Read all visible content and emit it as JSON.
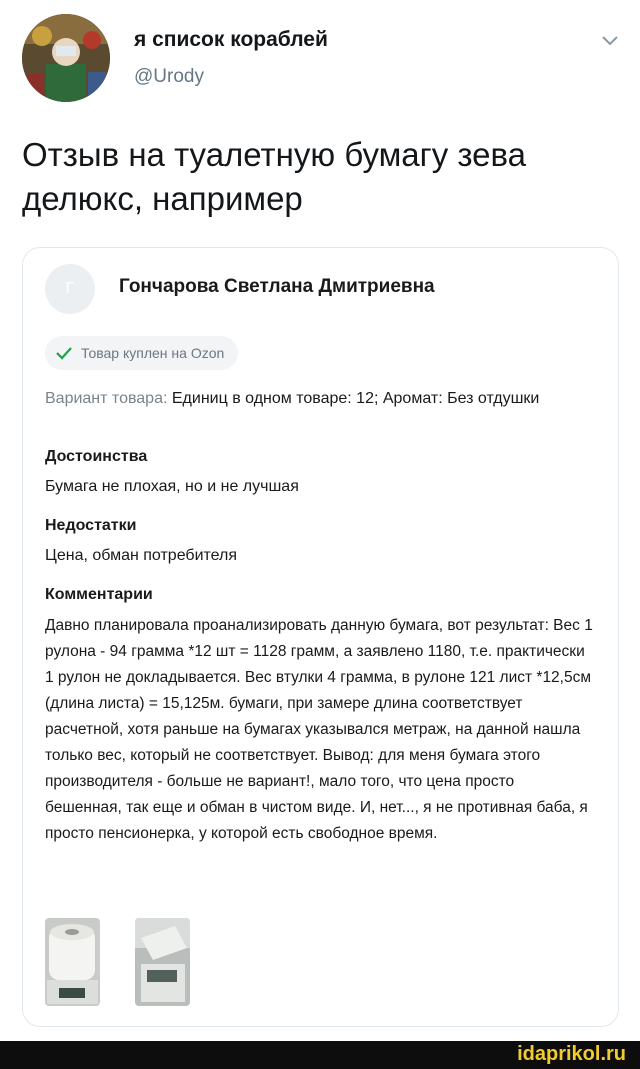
{
  "tweet": {
    "author_name": "я список кораблей",
    "handle": "@Urody",
    "text": "Отзыв на туалетную бумагу зева делюкс, например",
    "avatar_icon": "avatar-photo",
    "menu_icon": "chevron-down-icon"
  },
  "review": {
    "reviewer_initial": "Г",
    "reviewer_name": "Гончарова Светлана Дмитриевна",
    "badge": "Товар куплен на Ozon",
    "variant_label": "Вариант товара:",
    "variant_value": "Единиц в одном товаре: 12; Аромат: Без отдушки",
    "pros_title": "Достоинства",
    "pros_text": "Бумага не плохая, но и не лучшая",
    "cons_title": "Недостатки",
    "cons_text": "Цена, обман потребителя",
    "comment_title": "Комментарии",
    "comment_text": "Давно планировала проанализировать данную бумага, вот результат: Вес 1 рулона - 94 грамма *12 шт = 1128 грамм, а заявлено 1180, т.е. практически 1 рулон не докладывается. Вес втулки 4 грамма, в рулоне 121 лист *12,5см (длина листа) = 15,125м. бумаги, при замере длина соответствует расчетной, хотя раньше на бумагах указывался метраж, на данной нашла только вес, который не соответствует. Вывод: для меня бумага этого производителя - больше не вариант!, мало того, что цена просто бешенная, так еще и обман в чистом виде. И, нет..., я не противная баба, я просто пенсионерка, у которой есть свободное время."
  },
  "watermark": "idaprikol.ru",
  "colors": {
    "check": "#1aa34a",
    "handle": "#657786",
    "watermark": "#f2cc2e"
  }
}
